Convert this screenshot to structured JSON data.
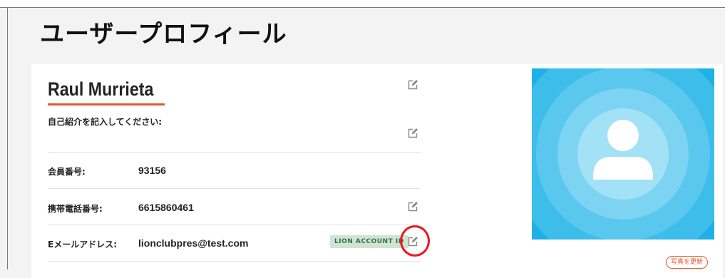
{
  "page": {
    "title": "ユーザープロフィール"
  },
  "profile": {
    "name": "Raul Murrieta",
    "bio_prompt": "自己紹介を記入してください:",
    "fields": [
      {
        "label": "会員番号:",
        "value": "93156"
      },
      {
        "label": "携帯電話番号:",
        "value": "6615860461"
      },
      {
        "label": "Eメールアドレス:",
        "value": "lionclubpres@test.com",
        "badge": "LION ACCOUNT ID"
      }
    ]
  },
  "photo": {
    "update_label": "写真を更新"
  },
  "icons": {
    "edit": "edit-icon",
    "avatar": "user-silhouette-icon"
  },
  "colors": {
    "accent": "#e4572e",
    "avatar_bg": "#1fb1e6",
    "badge_bg": "#cfe4d3",
    "badge_text": "#3b6e4a",
    "highlight": "#e8191c"
  }
}
